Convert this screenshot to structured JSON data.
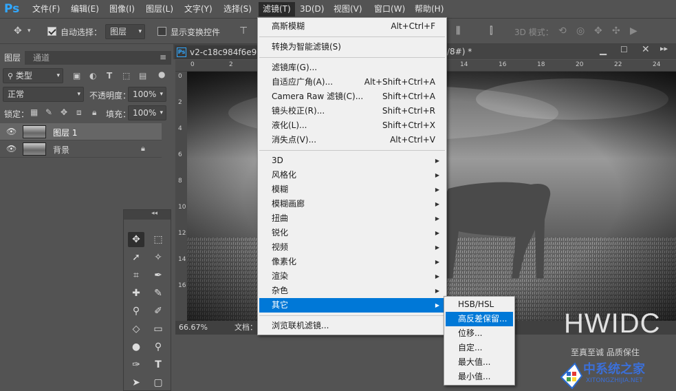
{
  "app": {
    "logo": "Ps"
  },
  "menubar": {
    "items": [
      "文件(F)",
      "编辑(E)",
      "图像(I)",
      "图层(L)",
      "文字(Y)",
      "选择(S)",
      "滤镜(T)",
      "3D(D)",
      "视图(V)",
      "窗口(W)",
      "帮助(H)"
    ],
    "active_index": 6
  },
  "options_bar": {
    "auto_select_label": "自动选择：",
    "auto_select_checked": true,
    "auto_select_target": "图层",
    "transform_controls_label": "显示变换控件",
    "transform_controls_checked": false,
    "mode_3d_label": "3D 模式："
  },
  "layers_panel": {
    "tabs": [
      "图层",
      "通道"
    ],
    "filter_kind": "类型",
    "blend_mode": "正常",
    "opacity_label": "不透明度：",
    "opacity_value": "100%",
    "lock_label": "锁定：",
    "fill_label": "填充：",
    "fill_value": "100%",
    "layers": [
      {
        "name": "图层 1",
        "selected": true,
        "locked": false
      },
      {
        "name": "背景",
        "selected": false,
        "locked": true
      }
    ]
  },
  "document": {
    "tab_title": "v2-c18c984f6e98",
    "tab_title_suffix": "/8#) *",
    "ruler_top_ticks": [
      "0",
      "2",
      "4",
      "6",
      "8",
      "10",
      "12",
      "14",
      "16",
      "18",
      "20",
      "22",
      "24"
    ],
    "ruler_left_ticks": [
      "0",
      "2",
      "4",
      "6",
      "8",
      "10",
      "12",
      "14",
      "16"
    ],
    "zoom": "66.67%",
    "status_label": "文档："
  },
  "filter_menu": {
    "items": [
      {
        "label": "高斯模糊",
        "shortcut": "Alt+Ctrl+F"
      },
      {
        "separator": true
      },
      {
        "label": "转换为智能滤镜(S)"
      },
      {
        "separator": true
      },
      {
        "label": "滤镜库(G)..."
      },
      {
        "label": "自适应广角(A)...",
        "shortcut": "Alt+Shift+Ctrl+A"
      },
      {
        "label": "Camera Raw 滤镜(C)...",
        "shortcut": "Shift+Ctrl+A"
      },
      {
        "label": "镜头校正(R)...",
        "shortcut": "Shift+Ctrl+R"
      },
      {
        "label": "液化(L)...",
        "shortcut": "Shift+Ctrl+X"
      },
      {
        "label": "消失点(V)...",
        "shortcut": "Alt+Ctrl+V"
      },
      {
        "separator": true
      },
      {
        "label": "3D",
        "submenu": true
      },
      {
        "label": "风格化",
        "submenu": true
      },
      {
        "label": "模糊",
        "submenu": true
      },
      {
        "label": "模糊画廊",
        "submenu": true
      },
      {
        "label": "扭曲",
        "submenu": true
      },
      {
        "label": "锐化",
        "submenu": true
      },
      {
        "label": "视频",
        "submenu": true
      },
      {
        "label": "像素化",
        "submenu": true
      },
      {
        "label": "渲染",
        "submenu": true
      },
      {
        "label": "杂色",
        "submenu": true
      },
      {
        "label": "其它",
        "submenu": true,
        "highlighted": true
      },
      {
        "separator": true
      },
      {
        "label": "浏览联机滤镜..."
      }
    ]
  },
  "other_submenu": {
    "items": [
      {
        "label": "HSB/HSL"
      },
      {
        "label": "高反差保留...",
        "highlighted": true
      },
      {
        "label": "位移..."
      },
      {
        "label": "自定..."
      },
      {
        "label": "最大值..."
      },
      {
        "label": "最小值..."
      }
    ]
  },
  "watermark": {
    "brand": "HWIDC",
    "slogan": "至真至诚 品质保住",
    "site_name": "中系统之家",
    "site_url": "XITONGZHIJIA.NET"
  },
  "colors": {
    "accent": "#0078d7",
    "ps_blue": "#31a8ff",
    "ui_gray": "#535353"
  }
}
